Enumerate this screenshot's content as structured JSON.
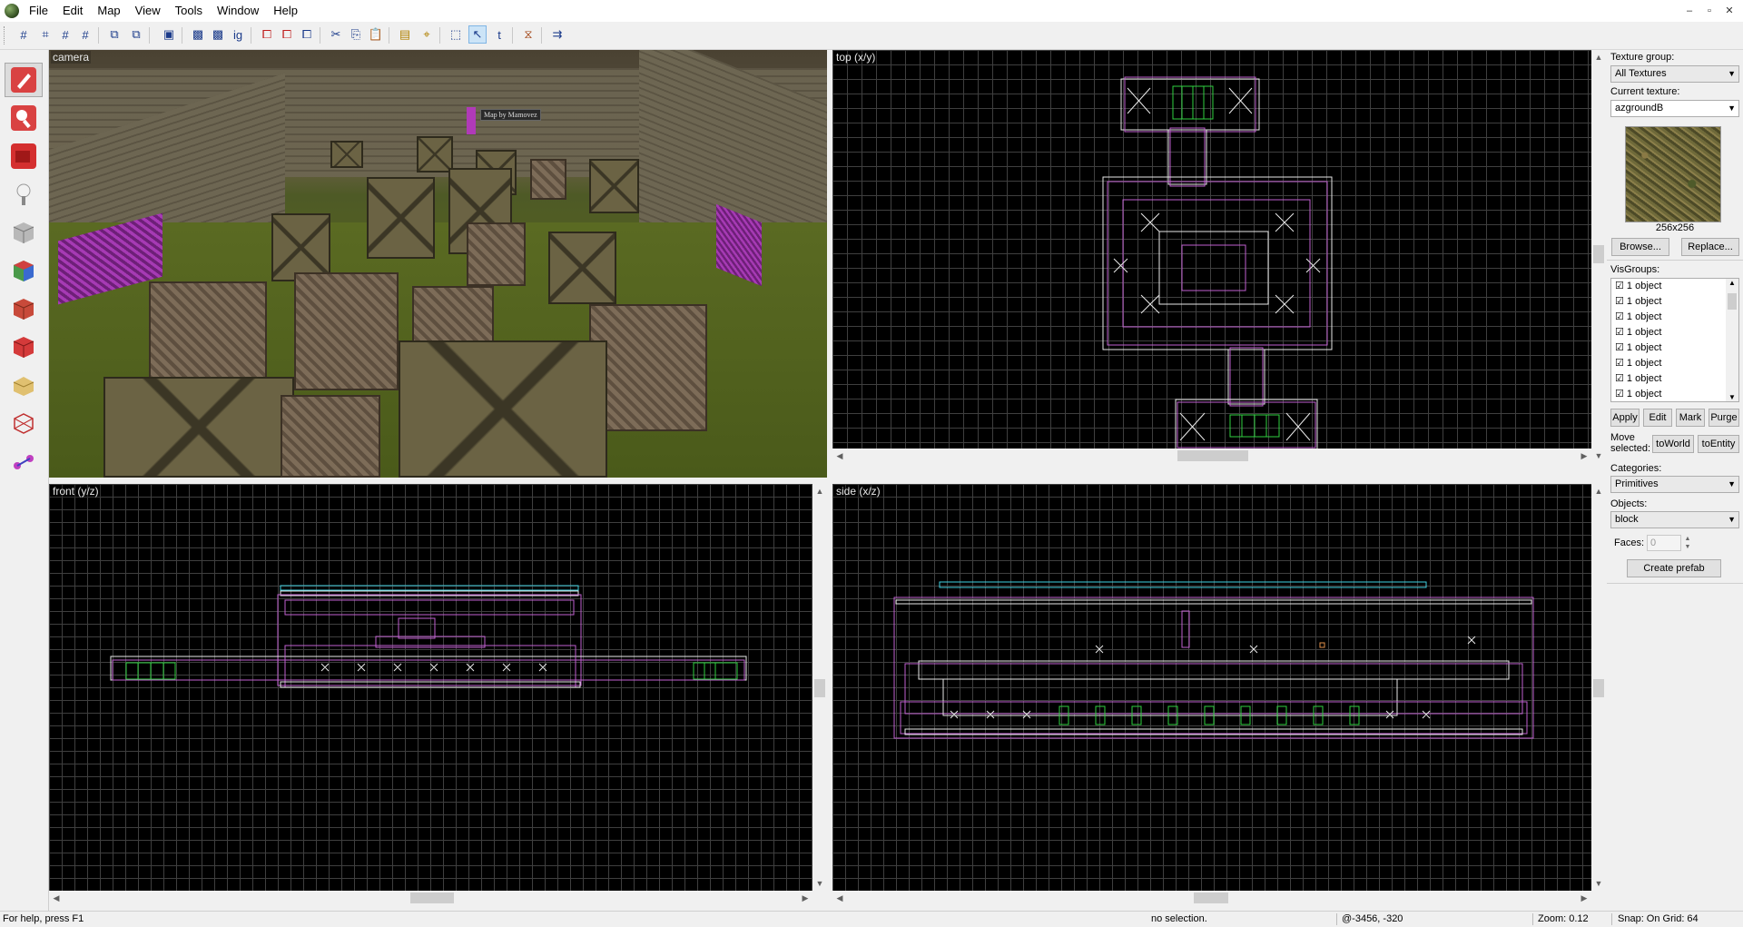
{
  "menu": [
    "File",
    "Edit",
    "Map",
    "View",
    "Tools",
    "Window",
    "Help"
  ],
  "window_buttons": [
    "–",
    "▫",
    "✕"
  ],
  "viewports": {
    "camera": "camera",
    "top": "top (x/y)",
    "front": "front (y/z)",
    "side": "side (x/z)"
  },
  "camera_sign": "Map by Mamovez",
  "right_panel": {
    "texture_group_label": "Texture group:",
    "texture_group_value": "All Textures",
    "current_texture_label": "Current texture:",
    "current_texture_value": "azgroundB",
    "texture_size": "256x256",
    "browse_label": "Browse...",
    "replace_label": "Replace...",
    "visgroups_label": "VisGroups:",
    "visgroups": [
      "1 object",
      "1 object",
      "1 object",
      "1 object",
      "1 object",
      "1 object",
      "1 object",
      "1 object"
    ],
    "apply_label": "Apply",
    "edit_label": "Edit",
    "mark_label": "Mark",
    "purge_label": "Purge",
    "move_selected_label": "Move\nselected:",
    "to_world_label": "toWorld",
    "to_entity_label": "toEntity",
    "categories_label": "Categories:",
    "categories_value": "Primitives",
    "objects_label": "Objects:",
    "objects_value": "block",
    "faces_label": "Faces:",
    "faces_value": "0",
    "create_prefab_label": "Create prefab"
  },
  "status": {
    "help": "For help, press F1",
    "selection": "no selection.",
    "coords": "@-3456, -320",
    "zoom": "Zoom: 0.12",
    "snap": "Snap: On Grid: 64"
  },
  "colors": {
    "brush_pink": "#c060d0",
    "brush_white": "#e8e8e8",
    "entity_green": "#2fd040",
    "entity_cyan": "#40d0e0",
    "grid": "#3f3f3f"
  },
  "tools": [
    "selection-tool",
    "magnify-tool",
    "camera-tool",
    "entity-tool",
    "block-tool",
    "texture-tool",
    "apply-texture-tool",
    "decal-tool",
    "overlay-tool",
    "clip-tool",
    "vertex-tool"
  ]
}
